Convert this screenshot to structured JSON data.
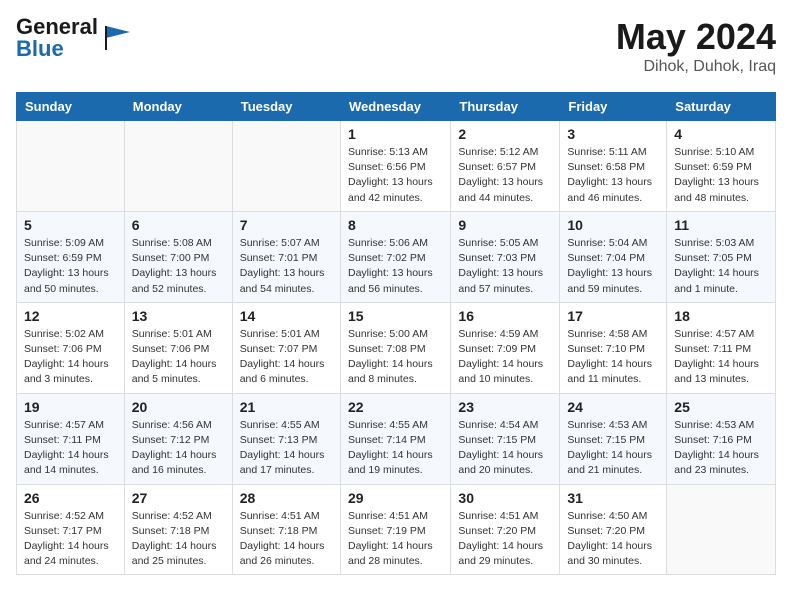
{
  "header": {
    "logo_general": "General",
    "logo_blue": "Blue",
    "title": "May 2024",
    "location": "Dihok, Duhok, Iraq"
  },
  "weekdays": [
    "Sunday",
    "Monday",
    "Tuesday",
    "Wednesday",
    "Thursday",
    "Friday",
    "Saturday"
  ],
  "weeks": [
    [
      {
        "day": "",
        "info": ""
      },
      {
        "day": "",
        "info": ""
      },
      {
        "day": "",
        "info": ""
      },
      {
        "day": "1",
        "info": "Sunrise: 5:13 AM\nSunset: 6:56 PM\nDaylight: 13 hours\nand 42 minutes."
      },
      {
        "day": "2",
        "info": "Sunrise: 5:12 AM\nSunset: 6:57 PM\nDaylight: 13 hours\nand 44 minutes."
      },
      {
        "day": "3",
        "info": "Sunrise: 5:11 AM\nSunset: 6:58 PM\nDaylight: 13 hours\nand 46 minutes."
      },
      {
        "day": "4",
        "info": "Sunrise: 5:10 AM\nSunset: 6:59 PM\nDaylight: 13 hours\nand 48 minutes."
      }
    ],
    [
      {
        "day": "5",
        "info": "Sunrise: 5:09 AM\nSunset: 6:59 PM\nDaylight: 13 hours\nand 50 minutes."
      },
      {
        "day": "6",
        "info": "Sunrise: 5:08 AM\nSunset: 7:00 PM\nDaylight: 13 hours\nand 52 minutes."
      },
      {
        "day": "7",
        "info": "Sunrise: 5:07 AM\nSunset: 7:01 PM\nDaylight: 13 hours\nand 54 minutes."
      },
      {
        "day": "8",
        "info": "Sunrise: 5:06 AM\nSunset: 7:02 PM\nDaylight: 13 hours\nand 56 minutes."
      },
      {
        "day": "9",
        "info": "Sunrise: 5:05 AM\nSunset: 7:03 PM\nDaylight: 13 hours\nand 57 minutes."
      },
      {
        "day": "10",
        "info": "Sunrise: 5:04 AM\nSunset: 7:04 PM\nDaylight: 13 hours\nand 59 minutes."
      },
      {
        "day": "11",
        "info": "Sunrise: 5:03 AM\nSunset: 7:05 PM\nDaylight: 14 hours\nand 1 minute."
      }
    ],
    [
      {
        "day": "12",
        "info": "Sunrise: 5:02 AM\nSunset: 7:06 PM\nDaylight: 14 hours\nand 3 minutes."
      },
      {
        "day": "13",
        "info": "Sunrise: 5:01 AM\nSunset: 7:06 PM\nDaylight: 14 hours\nand 5 minutes."
      },
      {
        "day": "14",
        "info": "Sunrise: 5:01 AM\nSunset: 7:07 PM\nDaylight: 14 hours\nand 6 minutes."
      },
      {
        "day": "15",
        "info": "Sunrise: 5:00 AM\nSunset: 7:08 PM\nDaylight: 14 hours\nand 8 minutes."
      },
      {
        "day": "16",
        "info": "Sunrise: 4:59 AM\nSunset: 7:09 PM\nDaylight: 14 hours\nand 10 minutes."
      },
      {
        "day": "17",
        "info": "Sunrise: 4:58 AM\nSunset: 7:10 PM\nDaylight: 14 hours\nand 11 minutes."
      },
      {
        "day": "18",
        "info": "Sunrise: 4:57 AM\nSunset: 7:11 PM\nDaylight: 14 hours\nand 13 minutes."
      }
    ],
    [
      {
        "day": "19",
        "info": "Sunrise: 4:57 AM\nSunset: 7:11 PM\nDaylight: 14 hours\nand 14 minutes."
      },
      {
        "day": "20",
        "info": "Sunrise: 4:56 AM\nSunset: 7:12 PM\nDaylight: 14 hours\nand 16 minutes."
      },
      {
        "day": "21",
        "info": "Sunrise: 4:55 AM\nSunset: 7:13 PM\nDaylight: 14 hours\nand 17 minutes."
      },
      {
        "day": "22",
        "info": "Sunrise: 4:55 AM\nSunset: 7:14 PM\nDaylight: 14 hours\nand 19 minutes."
      },
      {
        "day": "23",
        "info": "Sunrise: 4:54 AM\nSunset: 7:15 PM\nDaylight: 14 hours\nand 20 minutes."
      },
      {
        "day": "24",
        "info": "Sunrise: 4:53 AM\nSunset: 7:15 PM\nDaylight: 14 hours\nand 21 minutes."
      },
      {
        "day": "25",
        "info": "Sunrise: 4:53 AM\nSunset: 7:16 PM\nDaylight: 14 hours\nand 23 minutes."
      }
    ],
    [
      {
        "day": "26",
        "info": "Sunrise: 4:52 AM\nSunset: 7:17 PM\nDaylight: 14 hours\nand 24 minutes."
      },
      {
        "day": "27",
        "info": "Sunrise: 4:52 AM\nSunset: 7:18 PM\nDaylight: 14 hours\nand 25 minutes."
      },
      {
        "day": "28",
        "info": "Sunrise: 4:51 AM\nSunset: 7:18 PM\nDaylight: 14 hours\nand 26 minutes."
      },
      {
        "day": "29",
        "info": "Sunrise: 4:51 AM\nSunset: 7:19 PM\nDaylight: 14 hours\nand 28 minutes."
      },
      {
        "day": "30",
        "info": "Sunrise: 4:51 AM\nSunset: 7:20 PM\nDaylight: 14 hours\nand 29 minutes."
      },
      {
        "day": "31",
        "info": "Sunrise: 4:50 AM\nSunset: 7:20 PM\nDaylight: 14 hours\nand 30 minutes."
      },
      {
        "day": "",
        "info": ""
      }
    ]
  ]
}
